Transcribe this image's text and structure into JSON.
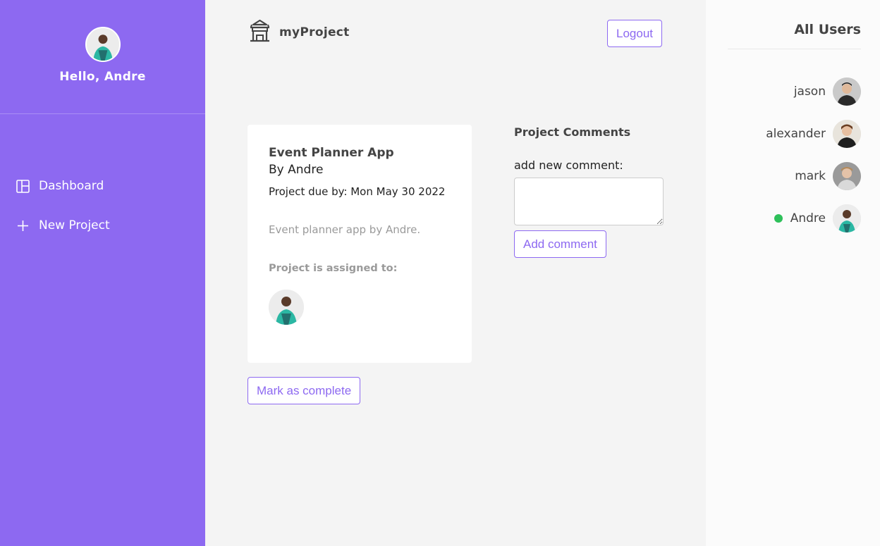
{
  "sidebar": {
    "greeting": "Hello, Andre",
    "nav": [
      {
        "label": "Dashboard",
        "icon": "dashboard-icon"
      },
      {
        "label": "New Project",
        "icon": "plus-icon"
      }
    ]
  },
  "header": {
    "brand": "myProject",
    "logout_label": "Logout"
  },
  "project": {
    "title": "Event Planner App",
    "author": "By Andre",
    "due": "Project due by: Mon May 30 2022",
    "description": "Event planner app by Andre.",
    "assigned_label": "Project is assigned to:",
    "complete_label": "Mark as complete"
  },
  "comments": {
    "title": "Project Comments",
    "input_label": "add new comment:",
    "input_value": "",
    "add_label": "Add comment"
  },
  "users": {
    "title": "All Users",
    "list": [
      {
        "name": "jason",
        "online": false
      },
      {
        "name": "alexander",
        "online": false
      },
      {
        "name": "mark",
        "online": false
      },
      {
        "name": "Andre",
        "online": true
      }
    ]
  },
  "colors": {
    "accent": "#8d69f1",
    "online": "#2ec05a"
  }
}
